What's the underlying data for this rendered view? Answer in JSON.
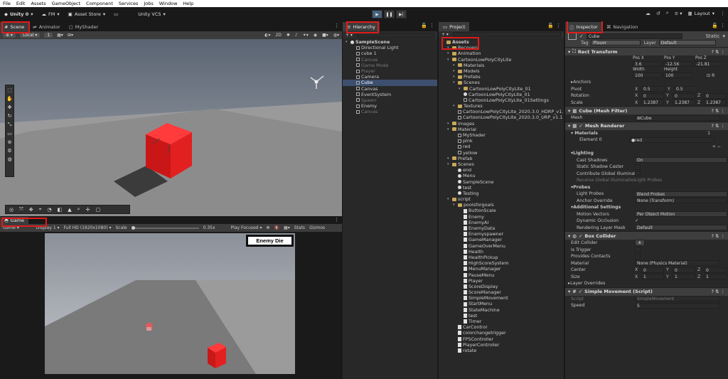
{
  "menubar": {
    "items": [
      "File",
      "Edit",
      "Assets",
      "GameObject",
      "Component",
      "Services",
      "Jobs",
      "Window",
      "Help"
    ]
  },
  "toolbar": {
    "account": "Unity 0",
    "branch": "FM",
    "asset_store": "Asset Store",
    "vcs": "Unity VCS",
    "layout": "Layout"
  },
  "scene_panel": {
    "tabs": [
      "Scene",
      "Animator",
      "MyShader"
    ],
    "pivot_dropdown": "Local",
    "snap_value": "1"
  },
  "game_panel": {
    "tab": "Game",
    "mode": "Game",
    "display": "Display 1",
    "resolution": "Full HD (1920x1080)",
    "scale_label": "Scale",
    "scale_value": "0.35x",
    "play_focused": "Play Focused",
    "stats": "Stats",
    "gizmos": "Gizmos",
    "overlay_text": "Enemy Die"
  },
  "hierarchy": {
    "tab": "Hierarchy",
    "items": [
      {
        "label": "SampleScene",
        "indent": 0,
        "icon": "unity",
        "style": "scene"
      },
      {
        "label": "Directional Light",
        "indent": 1,
        "icon": "cube",
        "style": ""
      },
      {
        "label": "cube 1",
        "indent": 1,
        "icon": "cube",
        "style": ""
      },
      {
        "label": "Canvas",
        "indent": 1,
        "icon": "cube",
        "style": "dim"
      },
      {
        "label": "Game Mode",
        "indent": 1,
        "icon": "cube",
        "style": "dim"
      },
      {
        "label": "Player",
        "indent": 1,
        "icon": "cube",
        "style": "dim"
      },
      {
        "label": "Camera",
        "indent": 1,
        "icon": "cube",
        "style": ""
      },
      {
        "label": "Cube",
        "indent": 1,
        "icon": "cube",
        "style": "sel"
      },
      {
        "label": "Canvas",
        "indent": 1,
        "icon": "cube",
        "style": ""
      },
      {
        "label": "EventSystem",
        "indent": 1,
        "icon": "cube",
        "style": ""
      },
      {
        "label": "Spawn",
        "indent": 1,
        "icon": "cube",
        "style": "dim"
      },
      {
        "label": "Enemy",
        "indent": 1,
        "icon": "cube",
        "style": ""
      },
      {
        "label": "Canvas",
        "indent": 1,
        "icon": "cube",
        "style": "dim"
      }
    ]
  },
  "project": {
    "tab": "Project",
    "items": [
      {
        "label": "Assets",
        "indent": 0,
        "icon": "folder",
        "style": "bold"
      },
      {
        "label": "Recovery",
        "indent": 1,
        "icon": "folder",
        "style": ""
      },
      {
        "label": "Animation",
        "indent": 1,
        "icon": "folder",
        "style": ""
      },
      {
        "label": "CartoonLowPolyCityLite",
        "indent": 1,
        "icon": "folder",
        "style": ""
      },
      {
        "label": "Materials",
        "indent": 2,
        "icon": "folder",
        "style": ""
      },
      {
        "label": "Models",
        "indent": 2,
        "icon": "folder",
        "style": ""
      },
      {
        "label": "Prefabs",
        "indent": 2,
        "icon": "folder",
        "style": ""
      },
      {
        "label": "Scenes",
        "indent": 2,
        "icon": "folder",
        "style": ""
      },
      {
        "label": "CartoonLowPolyCityLite_01",
        "indent": 3,
        "icon": "folder",
        "style": ""
      },
      {
        "label": "CartoonLowPolyCityLite_01",
        "indent": 3,
        "icon": "unity",
        "style": ""
      },
      {
        "label": "CartoonLowPolyCityLite_01Settings",
        "indent": 3,
        "icon": "cube",
        "style": ""
      },
      {
        "label": "Textures",
        "indent": 2,
        "icon": "folder",
        "style": ""
      },
      {
        "label": "CartoonLowPolyCityLite_2020.3.0_HDRP_v1.1",
        "indent": 2,
        "icon": "cube",
        "style": ""
      },
      {
        "label": "CartoonLowPolyCityLite_2020.3.0_URP_v1.1",
        "indent": 2,
        "icon": "cube",
        "style": ""
      },
      {
        "label": "Images",
        "indent": 1,
        "icon": "folder",
        "style": ""
      },
      {
        "label": "Material",
        "indent": 1,
        "icon": "folder",
        "style": ""
      },
      {
        "label": "MyShader",
        "indent": 2,
        "icon": "cube",
        "style": ""
      },
      {
        "label": "pink",
        "indent": 2,
        "icon": "cube",
        "style": ""
      },
      {
        "label": "red",
        "indent": 2,
        "icon": "cube",
        "style": ""
      },
      {
        "label": "yellow",
        "indent": 2,
        "icon": "cube",
        "style": ""
      },
      {
        "label": "Prefab",
        "indent": 1,
        "icon": "folder",
        "style": ""
      },
      {
        "label": "Scenes",
        "indent": 1,
        "icon": "folder",
        "style": ""
      },
      {
        "label": "end",
        "indent": 2,
        "icon": "unity",
        "style": ""
      },
      {
        "label": "Menu",
        "indent": 2,
        "icon": "unity",
        "style": ""
      },
      {
        "label": "SampleScene",
        "indent": 2,
        "icon": "unity",
        "style": ""
      },
      {
        "label": "test",
        "indent": 2,
        "icon": "unity",
        "style": ""
      },
      {
        "label": "Testing",
        "indent": 2,
        "icon": "unity",
        "style": ""
      },
      {
        "label": "script",
        "indent": 1,
        "icon": "folder",
        "style": ""
      },
      {
        "label": "poolsforgoals",
        "indent": 2,
        "icon": "folder",
        "style": ""
      },
      {
        "label": "ButtonScale",
        "indent": 3,
        "icon": "script",
        "style": ""
      },
      {
        "label": "Enemy",
        "indent": 3,
        "icon": "script",
        "style": ""
      },
      {
        "label": "EnemyAI",
        "indent": 3,
        "icon": "script",
        "style": ""
      },
      {
        "label": "EnemyData",
        "indent": 3,
        "icon": "script",
        "style": ""
      },
      {
        "label": "Enemyspawner",
        "indent": 3,
        "icon": "script",
        "style": ""
      },
      {
        "label": "GameManager",
        "indent": 3,
        "icon": "script",
        "style": ""
      },
      {
        "label": "GameOverMenu",
        "indent": 3,
        "icon": "script",
        "style": ""
      },
      {
        "label": "Health",
        "indent": 3,
        "icon": "script",
        "style": ""
      },
      {
        "label": "HealthPickup",
        "indent": 3,
        "icon": "script",
        "style": ""
      },
      {
        "label": "HighScoreSystem",
        "indent": 3,
        "icon": "script",
        "style": ""
      },
      {
        "label": "MenuManager",
        "indent": 3,
        "icon": "script",
        "style": ""
      },
      {
        "label": "PauseMenu",
        "indent": 3,
        "icon": "script",
        "style": ""
      },
      {
        "label": "Player",
        "indent": 3,
        "icon": "script",
        "style": ""
      },
      {
        "label": "ScoreDisplay",
        "indent": 3,
        "icon": "script",
        "style": ""
      },
      {
        "label": "ScoreManager",
        "indent": 3,
        "icon": "script",
        "style": ""
      },
      {
        "label": "SimpleMovement",
        "indent": 3,
        "icon": "script",
        "style": ""
      },
      {
        "label": "StartMenu",
        "indent": 3,
        "icon": "script",
        "style": ""
      },
      {
        "label": "StateMachine",
        "indent": 3,
        "icon": "script",
        "style": ""
      },
      {
        "label": "test",
        "indent": 3,
        "icon": "script",
        "style": ""
      },
      {
        "label": "Timer",
        "indent": 3,
        "icon": "script",
        "style": ""
      },
      {
        "label": "CarControl",
        "indent": 2,
        "icon": "script",
        "style": ""
      },
      {
        "label": "colorchangetrigger",
        "indent": 2,
        "icon": "script",
        "style": ""
      },
      {
        "label": "FPSController",
        "indent": 2,
        "icon": "script",
        "style": ""
      },
      {
        "label": "PlayerController",
        "indent": 2,
        "icon": "script",
        "style": ""
      },
      {
        "label": "rotate",
        "indent": 2,
        "icon": "script",
        "style": ""
      }
    ]
  },
  "inspector": {
    "tabs": [
      "Inspector",
      "Navigation"
    ],
    "object_name": "Cube",
    "static_label": "Static",
    "tag_label": "Tag",
    "tag_value": "Player",
    "layer_label": "Layer",
    "layer_value": "Default",
    "rect_transform": {
      "title": "Rect Transform",
      "pos_headers": [
        "Pos X",
        "Pos Y",
        "Pos Z"
      ],
      "pos_values": [
        "3.6",
        "-12.56",
        "-21.81"
      ],
      "size_headers": [
        "Width",
        "Height"
      ],
      "size_values": [
        "100",
        "100"
      ],
      "anchors": "Anchors",
      "pivot_label": "Pivot",
      "pivot": [
        "0.5",
        "0.5"
      ],
      "rotation_label": "Rotation",
      "rotation": [
        "0",
        "0",
        "0"
      ],
      "scale_label": "Scale",
      "scale": [
        "1.2387",
        "1.2387",
        "1.2387"
      ]
    },
    "mesh_filter": {
      "title": "Cube (Mesh Filter)",
      "mesh_label": "Mesh",
      "mesh_value": "Cube"
    },
    "mesh_renderer": {
      "title": "Mesh Renderer",
      "materials_label": "Materials",
      "materials_count": "1",
      "element_label": "Element 0",
      "element_value": "red",
      "lighting": "Lighting",
      "cast_shadows_label": "Cast Shadows",
      "cast_shadows_value": "On",
      "static_shadow": "Static Shadow Caster",
      "contribute_gi": "Contribute Global Illumination",
      "receive_gi_label": "Receive Global Illumination",
      "receive_gi_value": "Light Probes",
      "probes": "Probes",
      "light_probes_label": "Light Probes",
      "light_probes_value": "Blend Probes",
      "anchor_override_label": "Anchor Override",
      "anchor_override_value": "None (Transform)",
      "additional": "Additional Settings",
      "motion_vectors_label": "Motion Vectors",
      "motion_vectors_value": "Per Object Motion",
      "dynamic_occlusion": "Dynamic Occlusion",
      "rendering_layer_label": "Rendering Layer Mask",
      "rendering_layer_value": "Default"
    },
    "box_collider": {
      "title": "Box Collider",
      "edit_collider": "Edit Collider",
      "is_trigger": "Is Trigger",
      "provides_contacts": "Provides Contacts",
      "material_label": "Material",
      "material_value": "None (Physics Material)",
      "center_label": "Center",
      "center": [
        "0",
        "0",
        "0"
      ],
      "size_label": "Size",
      "size": [
        "1",
        "1",
        "1"
      ],
      "layer_overrides": "Layer Overrides"
    },
    "simple_movement": {
      "title": "Simple Movement (Script)",
      "script_label": "Script",
      "script_value": "SimpleMovement",
      "speed_label": "Speed",
      "speed_value": "5"
    }
  },
  "colors": {
    "highlight": "#e01b1b",
    "cube": "#e32020",
    "selection": "#3d4f6e"
  }
}
